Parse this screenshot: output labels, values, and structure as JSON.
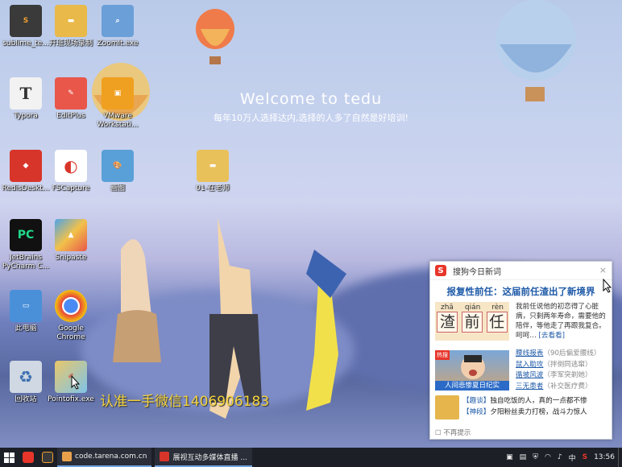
{
  "desktop": {
    "welcome": "Welcome to tedu",
    "slogan": "每年10万人选择达内,选择的人多了自然是好培训!",
    "watermark": "认准一手微信1406906183",
    "icons": [
      {
        "label": "sublime_te...",
        "color": "#3a3a3a",
        "glyph": "S"
      },
      {
        "label": "开班现场录制",
        "color": "#e9b949",
        "glyph": "▬"
      },
      {
        "label": "ZoomIt.exe",
        "color": "#6a9fd8",
        "glyph": "⌕"
      },
      {
        "label": "Typora",
        "color": "#f2f2f2",
        "glyph": "T"
      },
      {
        "label": "EditPlus",
        "color": "#e8574a",
        "glyph": "✎"
      },
      {
        "label": "VMware Workstati...",
        "color": "#f0a020",
        "glyph": "▣"
      },
      {
        "label": "RedisDeskt...",
        "color": "#d8352a",
        "glyph": "◆"
      },
      {
        "label": "FSCapture",
        "color": "#ffffff",
        "glyph": "◐"
      },
      {
        "label": "画图",
        "color": "#5aa0d8",
        "glyph": "🎨"
      },
      {
        "label": "01-在老师",
        "color": "#e9c15a",
        "glyph": "▬"
      },
      {
        "label": "JetBrains PyCharm C...",
        "color": "#21d789",
        "glyph": "PC"
      },
      {
        "label": "Snipaste",
        "color": "#4da3e8",
        "glyph": "▲"
      },
      {
        "label": "此电脑",
        "color": "#4a90d9",
        "glyph": "▭"
      },
      {
        "label": "Google Chrome",
        "color": "#ffffff",
        "glyph": "◉"
      },
      {
        "label": "回收站",
        "color": "#cfd8e3",
        "glyph": "♻"
      },
      {
        "label": "Pointofix.exe",
        "color": "#e8c76a",
        "glyph": "✐"
      }
    ]
  },
  "popup": {
    "title": "搜狗今日新词",
    "close": "×",
    "headline": "报复性前任：这届前任渣出了新境界",
    "pinyin": [
      "zhā",
      "qián",
      "rèn"
    ],
    "chars": [
      "渣",
      "前",
      "任"
    ],
    "lead": "我前任说他的初恋得了心脏病，只剩两年寿命，需要他的陪伴，等他走了再跟我复合。呵呵…",
    "lead_more": "[去看看]",
    "thumb_caption": "人间悲惨夏日纪实",
    "thumb_hot": "热搜",
    "links": [
      {
        "title": "腰线报表",
        "note": "（90后偏爱腰线）"
      },
      {
        "title": "鼠入助攻",
        "note": "（拌倒同逃窜）"
      },
      {
        "title": "循坡风波",
        "note": "（李军突剃她）"
      },
      {
        "title": "三无患者",
        "note": "（补交医疗费）"
      }
    ],
    "feed": [
      {
        "tag": "【趣谈】",
        "text": "独自吃饭的人，真的一点都不惨"
      },
      {
        "tag": "【神段】",
        "text": "夕阳粉丝卖力打榜，战斗力惊人"
      }
    ],
    "no_more": "不再提示"
  },
  "taskbar": {
    "apps": [
      {
        "label": "code.tarena.com.cn",
        "color": "#e8a14a"
      },
      {
        "label": "展视互动多媒体直播 ...",
        "color": "#d8352a"
      }
    ],
    "tray_lang": "中",
    "clock": "13:56"
  }
}
